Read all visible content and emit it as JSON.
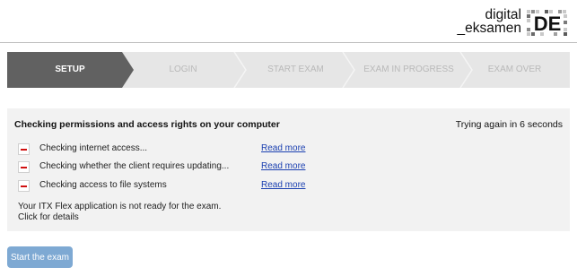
{
  "brand": {
    "line1": "digital",
    "line2": "_eksamen",
    "logo_letters": "DE"
  },
  "steps": [
    {
      "label": "SETUP",
      "state": "active"
    },
    {
      "label": "LOGIN",
      "state": "inactive"
    },
    {
      "label": "START EXAM",
      "state": "inactive"
    },
    {
      "label": "EXAM IN PROGRESS",
      "state": "inactive"
    },
    {
      "label": "EXAM OVER",
      "state": "inactive"
    }
  ],
  "panel": {
    "title": "Checking permissions and access rights on your computer",
    "retry": "Trying again in 6 seconds",
    "checks": [
      {
        "label": "Checking internet access...",
        "link": "Read more",
        "status": "failed"
      },
      {
        "label": "Checking whether the client requires updating...",
        "link": "Read more",
        "status": "failed"
      },
      {
        "label": "Checking access to file systems",
        "link": "Read more",
        "status": "failed"
      }
    ],
    "status_line1": "Your ITX Flex application is not ready for the exam.",
    "status_line2": "Click for details"
  },
  "start_button": "Start the exam",
  "colors": {
    "active_step": "#616161",
    "inactive_step": "#e6e6e6",
    "panel_bg": "#f2f2f2",
    "error_mark": "#d01010",
    "link": "#1a3fb0",
    "button_disabled": "#7ea9d3"
  }
}
